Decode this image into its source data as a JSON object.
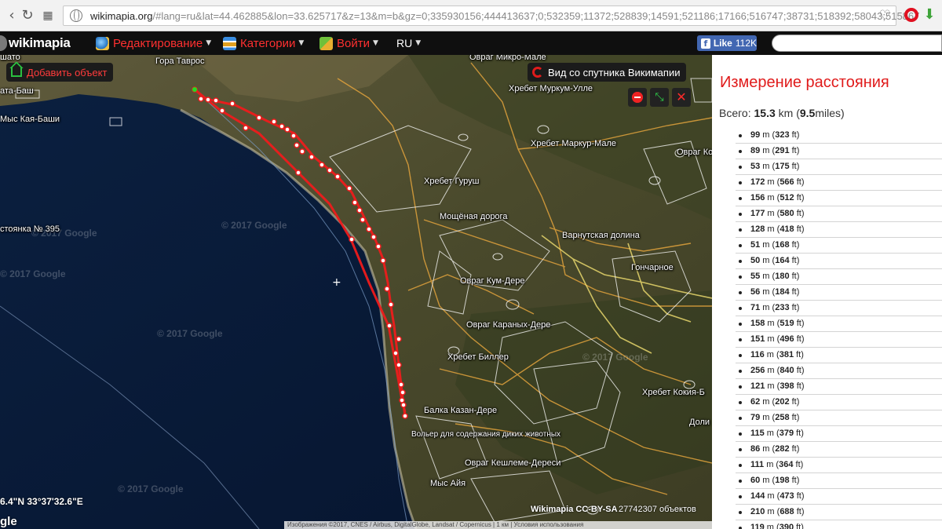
{
  "browser": {
    "url_host": "wikimapia.org",
    "url_rest": "/#lang=ru&lat=44.462885&lon=33.625717&z=13&m=b&gz=0;335930156;444413637;0;532359;11372;528839;14591;521186;17166;516747;38731;518392;58043;515867"
  },
  "topbar": {
    "logo": "wikimapia",
    "menu": {
      "edit": "Редактирование",
      "categories": "Категории",
      "login": "Войти",
      "language": "RU"
    },
    "facebook": {
      "label": "Like",
      "count": "112K"
    }
  },
  "map": {
    "add_object": "Добавить объект",
    "satellite_view": "Вид со спутника Викимапии",
    "coordinates": "6.4\"N 33°37'32.6\"E",
    "google_logo": "gle",
    "license": "Wikimapia CC-BY-SA",
    "object_count": "27742307 объектов",
    "attribution": "Изображения ©2017, CNES / Airbus, DigitalGlobe, Landsat / Copernicus | 1 км | Условия использования",
    "watermark": "© 2017 Google",
    "labels": [
      {
        "text": "Гора Таврос"
      },
      {
        "text": "Овраг Микро-Мале"
      },
      {
        "text": "ата-Баш"
      },
      {
        "text": "Мыс Кая-Баши"
      },
      {
        "text": "Хребет Муркум-Улле"
      },
      {
        "text": "Хребет Маркур-Мале"
      },
      {
        "text": "Овраг Ко"
      },
      {
        "text": "Хребет Гуруш"
      },
      {
        "text": "Мощёная дорога"
      },
      {
        "text": "Варнутская долина"
      },
      {
        "text": "Гончарное"
      },
      {
        "text": "стоянка № 395"
      },
      {
        "text": "Овраг Кум-Дере"
      },
      {
        "text": "Овраг Караных-Дере"
      },
      {
        "text": "Хребет Биллер"
      },
      {
        "text": "Хребет Кокия-Б"
      },
      {
        "text": "Балка Казан-Дере"
      },
      {
        "text": "Доли"
      },
      {
        "text": "Вольер для содержания диких животных"
      },
      {
        "text": "Овраг Кешлеме-Дереси"
      },
      {
        "text": "Мыс Айя"
      },
      {
        "text": "шато"
      }
    ]
  },
  "panel": {
    "title": "Измерение расстояния",
    "total_label": "Всего:",
    "total_km": "15.3",
    "km_unit": "km",
    "total_miles": "9.5",
    "miles_unit": "miles",
    "segments": [
      {
        "m": "99",
        "ft": "323"
      },
      {
        "m": "89",
        "ft": "291"
      },
      {
        "m": "53",
        "ft": "175"
      },
      {
        "m": "172",
        "ft": "566"
      },
      {
        "m": "156",
        "ft": "512"
      },
      {
        "m": "177",
        "ft": "580"
      },
      {
        "m": "128",
        "ft": "418"
      },
      {
        "m": "51",
        "ft": "168"
      },
      {
        "m": "50",
        "ft": "164"
      },
      {
        "m": "55",
        "ft": "180"
      },
      {
        "m": "56",
        "ft": "184"
      },
      {
        "m": "71",
        "ft": "233"
      },
      {
        "m": "158",
        "ft": "519"
      },
      {
        "m": "151",
        "ft": "496"
      },
      {
        "m": "116",
        "ft": "381"
      },
      {
        "m": "256",
        "ft": "840"
      },
      {
        "m": "121",
        "ft": "398"
      },
      {
        "m": "62",
        "ft": "202"
      },
      {
        "m": "79",
        "ft": "258"
      },
      {
        "m": "115",
        "ft": "379"
      },
      {
        "m": "86",
        "ft": "282"
      },
      {
        "m": "111",
        "ft": "364"
      },
      {
        "m": "60",
        "ft": "198"
      },
      {
        "m": "144",
        "ft": "473"
      },
      {
        "m": "210",
        "ft": "688"
      },
      {
        "m": "119",
        "ft": "390"
      }
    ]
  }
}
